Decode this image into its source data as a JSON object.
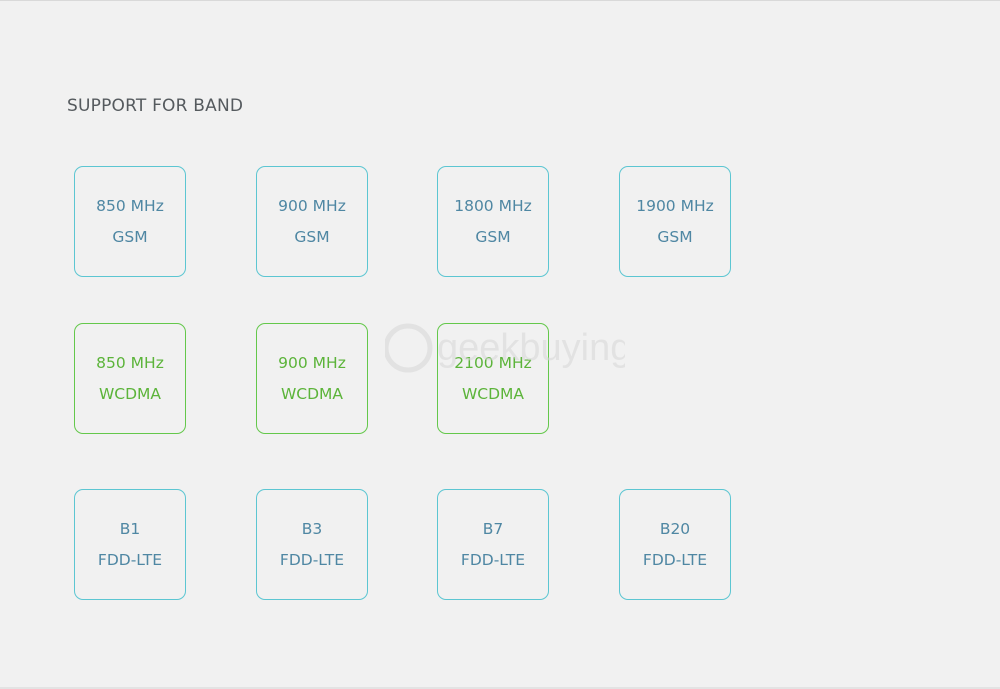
{
  "section": {
    "heading": "SUPPORT FOR BAND"
  },
  "watermark": {
    "text": "geekbuying",
    "color": "#d7d7d7"
  },
  "colors": {
    "background": "#f1f1f1",
    "tile_border_blue": "#5cc6d2",
    "tile_border_green": "#64c84b",
    "text_blue": "#4f87a3",
    "text_green": "#5cb43a"
  },
  "rows": {
    "gsm": [
      {
        "freq": "850 MHz",
        "type": "GSM"
      },
      {
        "freq": "900 MHz",
        "type": "GSM"
      },
      {
        "freq": "1800 MHz",
        "type": "GSM"
      },
      {
        "freq": "1900 MHz",
        "type": "GSM"
      }
    ],
    "wcdma": [
      {
        "freq": "850 MHz",
        "type": "WCDMA"
      },
      {
        "freq": "900 MHz",
        "type": "WCDMA"
      },
      {
        "freq": "2100 MHz",
        "type": "WCDMA"
      }
    ],
    "lte": [
      {
        "freq": "B1",
        "type": "FDD-LTE"
      },
      {
        "freq": "B3",
        "type": "FDD-LTE"
      },
      {
        "freq": "B7",
        "type": "FDD-LTE"
      },
      {
        "freq": "B20",
        "type": "FDD-LTE"
      }
    ]
  }
}
